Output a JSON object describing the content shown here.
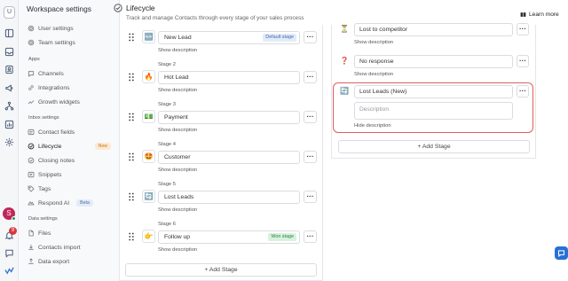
{
  "rail": {
    "workspace_initial": "U",
    "user_initial": "S",
    "notification_count": "9",
    "icons": [
      "contacts-icon",
      "inbox-icon",
      "contacts-book-icon",
      "broadcast-icon",
      "workflow-icon",
      "reports-icon",
      "settings-icon"
    ]
  },
  "sidebar": {
    "title": "Workspace settings",
    "items_top": [
      {
        "label": "User settings",
        "icon": "gear-icon"
      },
      {
        "label": "Team settings",
        "icon": "gear-icon"
      }
    ],
    "apps_header": "Apps",
    "apps": [
      {
        "label": "Channels",
        "icon": "chat-icon"
      },
      {
        "label": "Integrations",
        "icon": "link-icon"
      },
      {
        "label": "Growth widgets",
        "icon": "chart-icon"
      }
    ],
    "inbox_header": "Inbox settings",
    "inbox": [
      {
        "label": "Contact fields",
        "icon": "fields-icon"
      },
      {
        "label": "Lifecycle",
        "icon": "lifecycle-icon",
        "badge": "New",
        "active": true
      },
      {
        "label": "Closing notes",
        "icon": "check-circle-icon"
      },
      {
        "label": "Snippets",
        "icon": "snippet-icon"
      },
      {
        "label": "Tags",
        "icon": "tag-icon"
      },
      {
        "label": "Respond AI",
        "icon": "ai-icon",
        "badge": "Beta"
      }
    ],
    "data_header": "Data settings",
    "data": [
      {
        "label": "Files",
        "icon": "file-icon"
      },
      {
        "label": "Contacts import",
        "icon": "import-icon"
      },
      {
        "label": "Data export",
        "icon": "export-icon"
      }
    ]
  },
  "header": {
    "title": "Lifecycle",
    "subtitle": "Track and manage Contacts through every stage of your sales process",
    "learn_more": "Learn more"
  },
  "stages": [
    {
      "stage_label": "",
      "emoji": "🆕",
      "name": "New Lead",
      "badge": "Default stage",
      "badge_type": "default",
      "show_desc": "Show description"
    },
    {
      "stage_label": "Stage 2",
      "emoji": "🔥",
      "name": "Hot Lead",
      "badge": "",
      "badge_type": "",
      "show_desc": "Show description"
    },
    {
      "stage_label": "Stage 3",
      "emoji": "💵",
      "name": "Payment",
      "badge": "",
      "badge_type": "",
      "show_desc": "Show description"
    },
    {
      "stage_label": "Stage 4",
      "emoji": "🤩",
      "name": "Customer",
      "badge": "",
      "badge_type": "",
      "show_desc": "Show description"
    },
    {
      "stage_label": "Stage 5",
      "emoji": "🔄",
      "name": "Lost Leads",
      "badge": "",
      "badge_type": "",
      "show_desc": "Show description"
    },
    {
      "stage_label": "Stage 6",
      "emoji": "👉",
      "name": "Follow up",
      "badge": "Won stage",
      "badge_type": "won",
      "show_desc": "Show description"
    }
  ],
  "add_stage_label": "+ Add Stage",
  "lost_stages": [
    {
      "emoji": "⏳",
      "name": "Lost to competitor",
      "show_desc": "Show description"
    },
    {
      "emoji": "❓",
      "name": "No response",
      "show_desc": "Show description"
    }
  ],
  "editing_stage": {
    "emoji": "🔄",
    "name": "Lost Leads (New)",
    "description_placeholder": "Description",
    "hide_desc": "Hide description"
  },
  "colors": {
    "accent": "#2970d6",
    "highlight_border": "#e25d5d",
    "new_badge": "#fde9d1",
    "won_badge": "#d9f2df"
  }
}
